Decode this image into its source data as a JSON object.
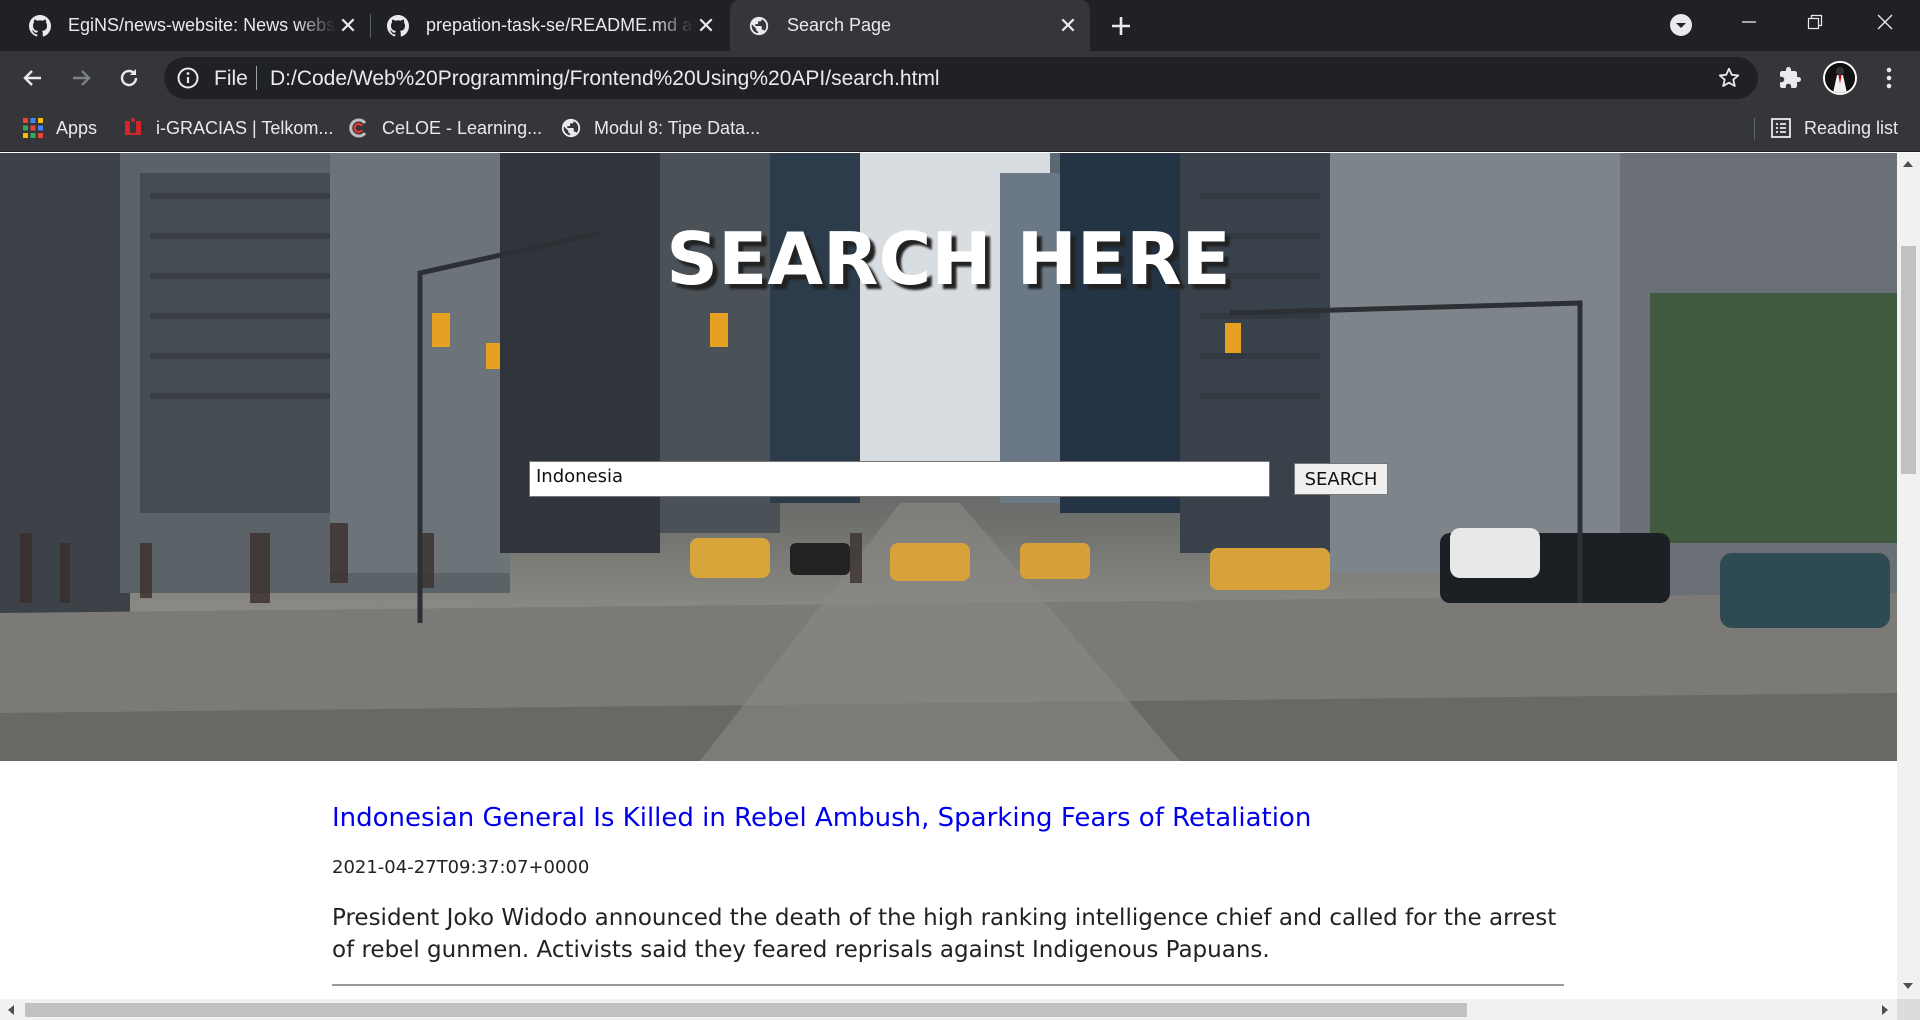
{
  "browser": {
    "tabs": [
      {
        "title": "EgiNS/news-website: News website",
        "icon": "github-icon",
        "active": false
      },
      {
        "title": "prepation-task-se/README.md at main",
        "icon": "github-icon",
        "active": false
      },
      {
        "title": "Search Page",
        "icon": "globe-icon",
        "active": true
      }
    ],
    "omnibox": {
      "scheme_label": "File",
      "url": "D:/Code/Web%20Programming/Frontend%20Using%20API/search.html"
    },
    "bookmarks": [
      {
        "label": "Apps",
        "icon": "apps-grid-icon"
      },
      {
        "label": "i-GRACIAS | Telkom...",
        "icon": "igracias-icon"
      },
      {
        "label": "CeLOE - Learning...",
        "icon": "celoe-icon"
      },
      {
        "label": "Modul 8: Tipe Data...",
        "icon": "globe-icon"
      }
    ],
    "reading_list": "Reading list"
  },
  "page": {
    "hero_title": "SEARCH HERE",
    "search_value": "Indonesia",
    "search_button": "SEARCH",
    "articles": [
      {
        "title": "Indonesian General Is Killed in Rebel Ambush, Sparking Fears of Retaliation",
        "date": "2021-04-27T09:37:07+0000",
        "description": "President Joko Widodo announced the death of the high ranking intelligence chief and called for the arrest of rebel gunmen. Activists said they feared reprisals against Indigenous Papuans."
      }
    ]
  }
}
